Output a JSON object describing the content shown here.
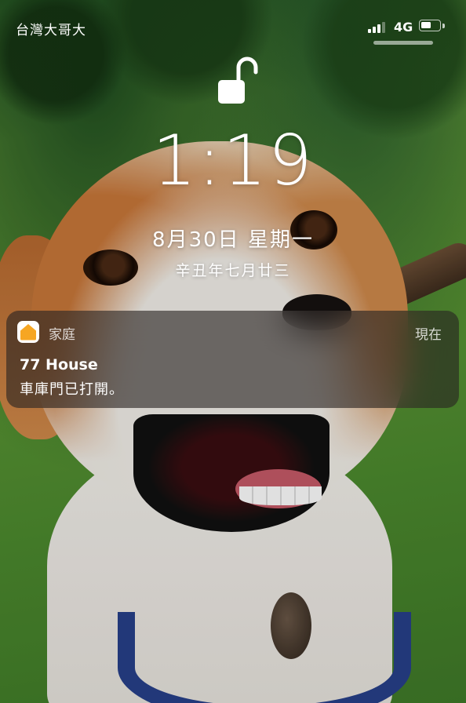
{
  "status_bar": {
    "carrier": "台灣大哥大",
    "network": "4G",
    "signal_bars_active": 3,
    "signal_bars_total": 4,
    "battery_level": 0.55
  },
  "lock_screen": {
    "lock_state": "unlocked",
    "time": "1:19",
    "date": "8月30日 星期一",
    "lunar_date": "辛丑年七月廿三"
  },
  "notification": {
    "app_icon": "home-app-icon",
    "app_name": "家庭",
    "time": "現在",
    "title": "77 House",
    "body": "車庫門已打開。"
  },
  "colors": {
    "home_icon": "#f6a623"
  }
}
